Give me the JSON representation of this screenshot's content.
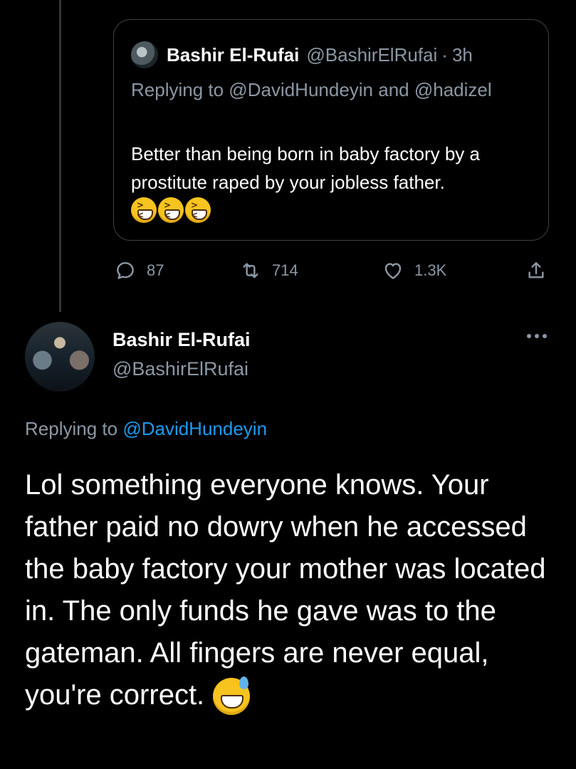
{
  "quoted": {
    "name": "Bashir El-Rufai",
    "handle": "@BashirElRufai",
    "separator": "·",
    "time": "3h",
    "replying": "Replying to @DavidHundeyin and @hadizel",
    "text": "Better than being born in baby factory by a prostitute raped by your jobless father.",
    "emoji": "grinning-squinting-face-emoji"
  },
  "actions": {
    "replies": "87",
    "retweets": "714",
    "likes": "1.3K"
  },
  "main": {
    "name": "Bashir El-Rufai",
    "handle": "@BashirElRufai",
    "replying_prefix": "Replying to ",
    "replying_to": "@DavidHundeyin",
    "text": "Lol something everyone knows. Your father paid no dowry when he accessed the baby factory your mother was located in. The only funds he gave was to the gateman. All fingers are never equal, you're correct.",
    "emoji": "grinning-face-with-sweat-emoji"
  },
  "colors": {
    "background": "#000000",
    "text": "#ffffff",
    "secondary": "#8b98a5",
    "link": "#1d9bf0",
    "border": "#3e4144"
  }
}
